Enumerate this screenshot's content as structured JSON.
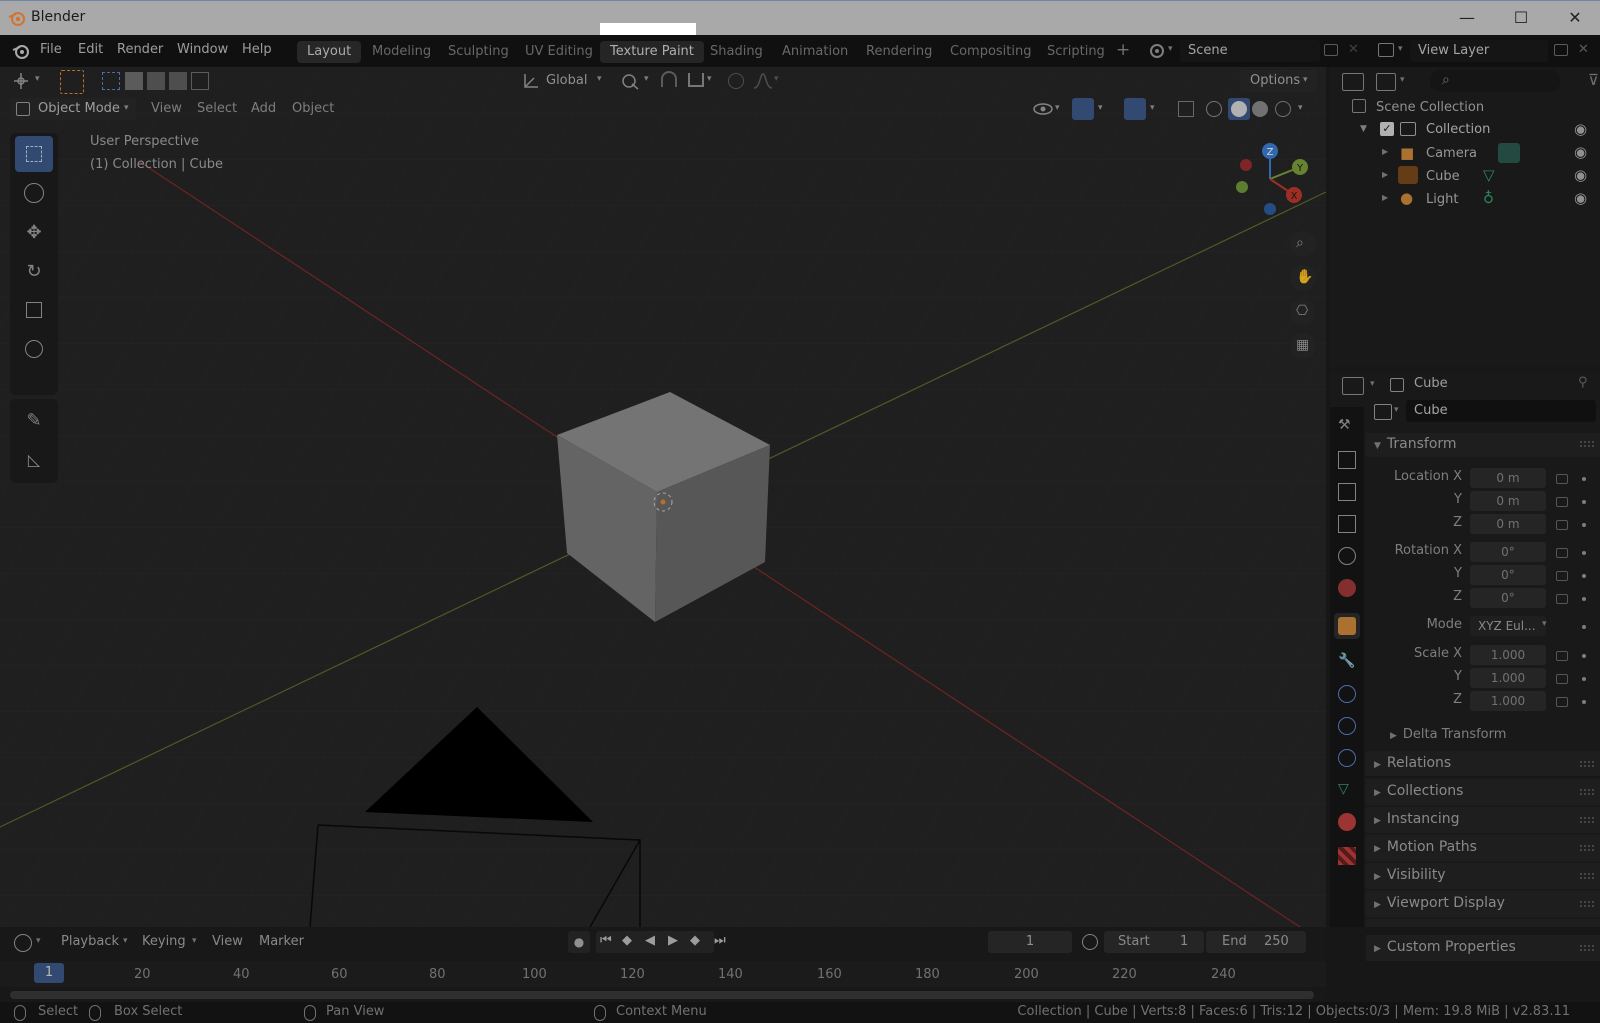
{
  "window": {
    "title": "Blender",
    "minimize": "—",
    "maximize": "☐",
    "close": "✕"
  },
  "menu": [
    "File",
    "Edit",
    "Render",
    "Window",
    "Help"
  ],
  "workspaces": [
    "Layout",
    "Modeling",
    "Sculpting",
    "UV Editing",
    "Texture Paint",
    "Shading",
    "Animation",
    "Rendering",
    "Compositing",
    "Scripting"
  ],
  "workspace_add": "+",
  "scene": {
    "name": "Scene"
  },
  "view_layer": {
    "name": "View Layer"
  },
  "viewport": {
    "orientation": "Global",
    "options": "Options",
    "mode": "Object Mode",
    "menus": [
      "View",
      "Select",
      "Add",
      "Object"
    ],
    "overlay_text_1": "User Perspective",
    "overlay_text_2": "(1) Collection | Cube",
    "gizmo": {
      "z": "Z",
      "y": "Y",
      "x": "X"
    }
  },
  "outliner": {
    "root": "Scene Collection",
    "collection": "Collection",
    "items": [
      "Camera",
      "Cube",
      "Light"
    ]
  },
  "properties": {
    "object_name": "Cube",
    "data_name": "Cube",
    "transform_title": "Transform",
    "location": {
      "label": "Location X",
      "x": "0 m",
      "y": "0 m",
      "z": "0 m"
    },
    "rotation": {
      "label": "Rotation X",
      "x": "0°",
      "y": "0°",
      "z": "0°"
    },
    "mode": {
      "label": "Mode",
      "value": "XYZ Eul..."
    },
    "scale": {
      "label": "Scale X",
      "x": "1.000",
      "y": "1.000",
      "z": "1.000"
    },
    "axis_y": "Y",
    "axis_z": "Z",
    "delta": "Delta Transform",
    "panels": [
      "Relations",
      "Collections",
      "Instancing",
      "Motion Paths",
      "Visibility",
      "Viewport Display",
      "Custom Properties"
    ]
  },
  "timeline": {
    "menus": [
      "Playback",
      "Keying",
      "View",
      "Marker"
    ],
    "current_frame": "1",
    "start_label": "Start",
    "start": "1",
    "end_label": "End",
    "end": "250",
    "cursor_frame": "1",
    "ticks": [
      "20",
      "40",
      "60",
      "80",
      "100",
      "120",
      "140",
      "160",
      "180",
      "200",
      "220",
      "240"
    ]
  },
  "status": {
    "select": "Select",
    "box_select": "Box Select",
    "pan_view": "Pan View",
    "context_menu": "Context Menu",
    "info": "Collection | Cube | Verts:8 | Faces:6 | Tris:12 | Objects:0/3 | Mem: 19.8 MiB | v2.83.11"
  },
  "colors": {
    "accent": "#3d5a8a",
    "x_axis": "#c0392b",
    "y_axis": "#7ea03a",
    "z_axis": "#3d7fd6",
    "object": "#e08a2e"
  }
}
